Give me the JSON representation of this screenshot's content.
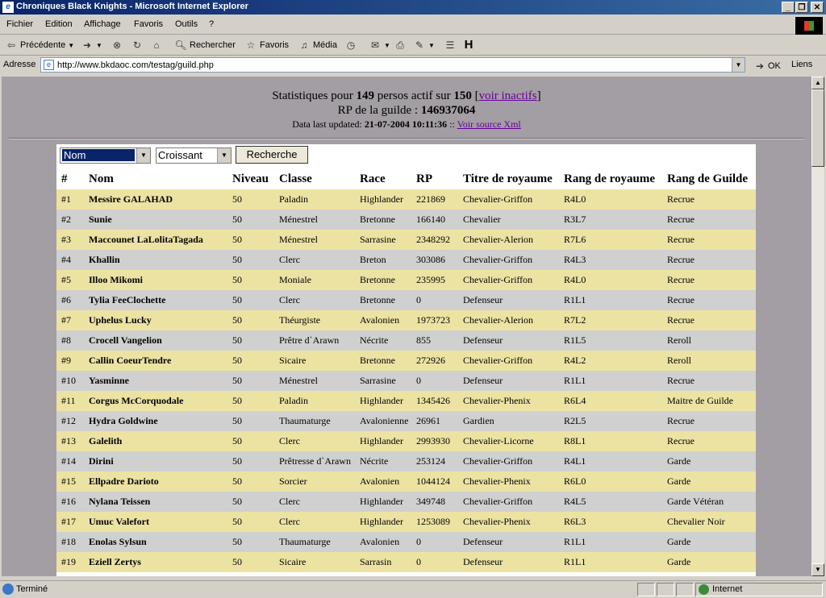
{
  "window": {
    "title": "Chroniques Black Knights - Microsoft Internet Explorer"
  },
  "menu": [
    "Fichier",
    "Edition",
    "Affichage",
    "Favoris",
    "Outils",
    "?"
  ],
  "toolbar": {
    "back": "Précédente",
    "search": "Rechercher",
    "favorites": "Favoris",
    "media": "Média"
  },
  "address": {
    "label": "Adresse",
    "url": "http://www.bkdaoc.com/testag/guild.php",
    "go": "OK",
    "links": "Liens"
  },
  "stats": {
    "prefix": "Statistiques pour",
    "count": "149",
    "mid": "persos actif sur",
    "total": "150",
    "inactive_link": "voir inactifs",
    "rp_label": "RP de la guilde :",
    "rp_value": "146937064",
    "updated_label": "Data last updated:",
    "updated_value": "21-07-2004 10:11:36",
    "sep": "::",
    "xml_link": "Voir source Xml"
  },
  "controls": {
    "sort_field": "Nom",
    "sort_order": "Croissant",
    "button": "Recherche"
  },
  "table": {
    "headers": [
      "#",
      "Nom",
      "Niveau",
      "Classe",
      "Race",
      "RP",
      "Titre de royaume",
      "Rang de royaume",
      "Rang de Guilde"
    ],
    "rows": [
      [
        "#1",
        "Messire GALAHAD",
        "50",
        "Paladin",
        "Highlander",
        "221869",
        "Chevalier-Griffon",
        "R4L0",
        "Recrue"
      ],
      [
        "#2",
        "Sunie",
        "50",
        "Ménestrel",
        "Bretonne",
        "166140",
        "Chevalier",
        "R3L7",
        "Recrue"
      ],
      [
        "#3",
        "Maccounet LaLolitaTagada",
        "50",
        "Ménestrel",
        "Sarrasine",
        "2348292",
        "Chevalier-Alerion",
        "R7L6",
        "Recrue"
      ],
      [
        "#4",
        "Khallin",
        "50",
        "Clerc",
        "Breton",
        "303086",
        "Chevalier-Griffon",
        "R4L3",
        "Recrue"
      ],
      [
        "#5",
        "Illoo Mikomi",
        "50",
        "Moniale",
        "Bretonne",
        "235995",
        "Chevalier-Griffon",
        "R4L0",
        "Recrue"
      ],
      [
        "#6",
        "Tylia FeeClochette",
        "50",
        "Clerc",
        "Bretonne",
        "0",
        "Defenseur",
        "R1L1",
        "Recrue"
      ],
      [
        "#7",
        "Uphelus Lucky",
        "50",
        "Théurgiste",
        "Avalonien",
        "1973723",
        "Chevalier-Alerion",
        "R7L2",
        "Recrue"
      ],
      [
        "#8",
        "Crocell Vangelion",
        "50",
        "Prêtre d`Arawn",
        "Nécrite",
        "855",
        "Defenseur",
        "R1L5",
        "Reroll"
      ],
      [
        "#9",
        "Callin CoeurTendre",
        "50",
        "Sicaire",
        "Bretonne",
        "272926",
        "Chevalier-Griffon",
        "R4L2",
        "Reroll"
      ],
      [
        "#10",
        "Yasminne",
        "50",
        "Ménestrel",
        "Sarrasine",
        "0",
        "Defenseur",
        "R1L1",
        "Recrue"
      ],
      [
        "#11",
        "Corgus McCorquodale",
        "50",
        "Paladin",
        "Highlander",
        "1345426",
        "Chevalier-Phenix",
        "R6L4",
        "Maitre de Guilde"
      ],
      [
        "#12",
        "Hydra Goldwine",
        "50",
        "Thaumaturge",
        "Avalonienne",
        "26961",
        "Gardien",
        "R2L5",
        "Recrue"
      ],
      [
        "#13",
        "Galelith",
        "50",
        "Clerc",
        "Highlander",
        "2993930",
        "Chevalier-Licorne",
        "R8L1",
        "Recrue"
      ],
      [
        "#14",
        "Dirini",
        "50",
        "Prêtresse d`Arawn",
        "Nécrite",
        "253124",
        "Chevalier-Griffon",
        "R4L1",
        "Garde"
      ],
      [
        "#15",
        "Ellpadre Darioto",
        "50",
        "Sorcier",
        "Avalonien",
        "1044124",
        "Chevalier-Phenix",
        "R6L0",
        "Garde"
      ],
      [
        "#16",
        "Nylana Teissen",
        "50",
        "Clerc",
        "Highlander",
        "349748",
        "Chevalier-Griffon",
        "R4L5",
        "Garde Vétéran"
      ],
      [
        "#17",
        "Umuc Valefort",
        "50",
        "Clerc",
        "Highlander",
        "1253089",
        "Chevalier-Phenix",
        "R6L3",
        "Chevalier Noir"
      ],
      [
        "#18",
        "Enolas Sylsun",
        "50",
        "Thaumaturge",
        "Avalonien",
        "0",
        "Defenseur",
        "R1L1",
        "Garde"
      ],
      [
        "#19",
        "Eziell Zertys",
        "50",
        "Sicaire",
        "Sarrasin",
        "0",
        "Defenseur",
        "R1L1",
        "Garde"
      ]
    ]
  },
  "status": {
    "text": "Terminé",
    "zone": "Internet"
  }
}
